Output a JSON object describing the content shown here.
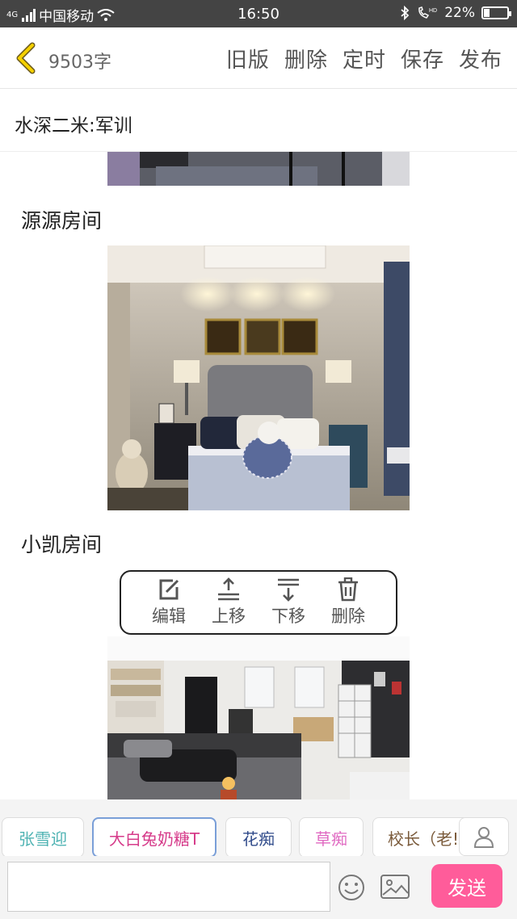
{
  "status_bar": {
    "network": "4G",
    "carrier": "中国移动",
    "time": "16:50",
    "battery": "22%",
    "battery_level": 0.22
  },
  "header": {
    "word_count": "9503字",
    "actions": [
      "旧版",
      "删除",
      "定时",
      "保存",
      "发布"
    ]
  },
  "article": {
    "title": "水深二米:军训",
    "sections": [
      {
        "heading": "源源房间"
      },
      {
        "heading": "小凯房间"
      }
    ]
  },
  "image_toolbar": {
    "items": [
      {
        "label": "编辑",
        "icon": "edit-icon"
      },
      {
        "label": "上移",
        "icon": "move-up-icon"
      },
      {
        "label": "下移",
        "icon": "move-down-icon"
      },
      {
        "label": "删除",
        "icon": "trash-icon"
      }
    ]
  },
  "mention_chips": [
    {
      "label": "张雪迎",
      "color": "#4fb3b3"
    },
    {
      "label": "大白兔奶糖T",
      "color": "#d63b8a"
    },
    {
      "label": "花痴",
      "color": "#2f4a8a"
    },
    {
      "label": "草痴",
      "color": "#e06ac2"
    },
    {
      "label": "校长（老!",
      "color": "#7a5a3a"
    }
  ],
  "composer": {
    "send_label": "发送",
    "accent": "#ff5c9a"
  }
}
